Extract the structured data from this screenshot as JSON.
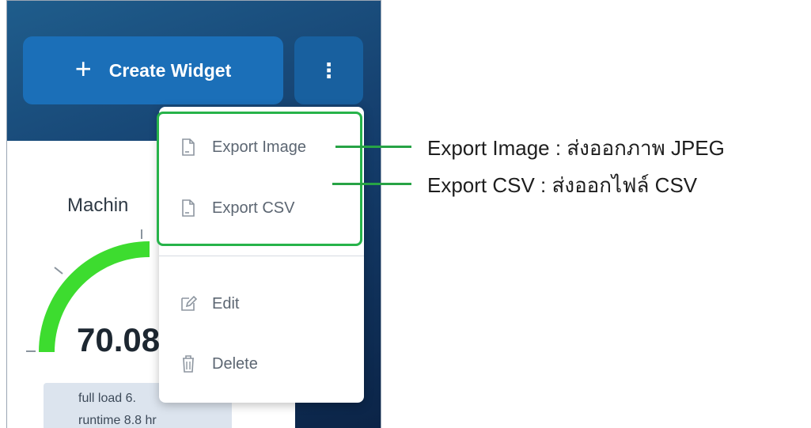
{
  "toolbar": {
    "create_icon": "plus-icon",
    "create_label": "Create Widget",
    "more_icon": "kebab-menu-icon"
  },
  "widget": {
    "title": "Machin",
    "value": "70.08",
    "info_lines": [
      "full load 6.",
      "runtime 8.8 hr"
    ],
    "gauge_color": "#3ddc2f",
    "gauge_fill": 0.7
  },
  "menu": {
    "items": [
      {
        "label": "Export Image",
        "icon": "file-icon"
      },
      {
        "label": "Export CSV",
        "icon": "file-icon"
      },
      {
        "label": "Edit",
        "icon": "edit-icon"
      },
      {
        "label": "Delete",
        "icon": "trash-icon"
      }
    ]
  },
  "callouts": [
    "Export Image : ส่งออกภาพ JPEG",
    "Export CSV : ส่งออกไฟล์ CSV"
  ],
  "colors": {
    "accent_blue": "#1b6fb8",
    "highlight_green": "#27b34a",
    "menu_text": "#5c6672"
  }
}
